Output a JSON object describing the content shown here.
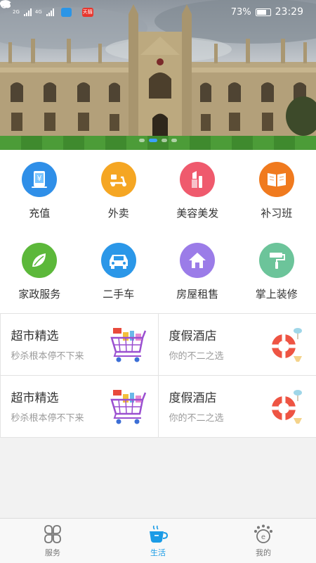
{
  "statusbar": {
    "net1": "2G",
    "net2": "4G",
    "battery": "73%",
    "time": "23:29",
    "badge_text": "天猫"
  },
  "banner": {
    "image_name": "university-college-building",
    "dots_total": 4,
    "dots_active": 2
  },
  "services": [
    {
      "label": "充值",
      "icon": "recharge-icon",
      "color": "#2f8fe8"
    },
    {
      "label": "外卖",
      "icon": "scooter-icon",
      "color": "#f5a623"
    },
    {
      "label": "美容美发",
      "icon": "lipstick-icon",
      "color": "#ef5a6d"
    },
    {
      "label": "补习班",
      "icon": "book-icon",
      "color": "#f07a1e"
    },
    {
      "label": "家政服务",
      "icon": "leaf-icon",
      "color": "#5cb83a"
    },
    {
      "label": "二手车",
      "icon": "car-icon",
      "color": "#2b97e8"
    },
    {
      "label": "房屋租售",
      "icon": "house-icon",
      "color": "#9b7ce8"
    },
    {
      "label": "掌上装修",
      "icon": "paint-roller-icon",
      "color": "#6cc49a"
    }
  ],
  "promos": [
    {
      "title": "超市精选",
      "subtitle": "秒杀根本停不下来",
      "icon": "shopping-cart-icon"
    },
    {
      "title": "度假酒店",
      "subtitle": "你的不二之选",
      "icon": "lifebuoy-icon"
    },
    {
      "title": "超市精选",
      "subtitle": "秒杀根本停不下来",
      "icon": "shopping-cart-icon"
    },
    {
      "title": "度假酒店",
      "subtitle": "你的不二之选",
      "icon": "lifebuoy-icon"
    }
  ],
  "nav": {
    "items": [
      {
        "label": "服务",
        "icon": "clover-icon",
        "active": false
      },
      {
        "label": "生活",
        "icon": "coffee-cup-icon",
        "active": true
      },
      {
        "label": "我的",
        "icon": "profile-badge-icon",
        "active": false
      }
    ],
    "active_color": "#1a9be6"
  }
}
